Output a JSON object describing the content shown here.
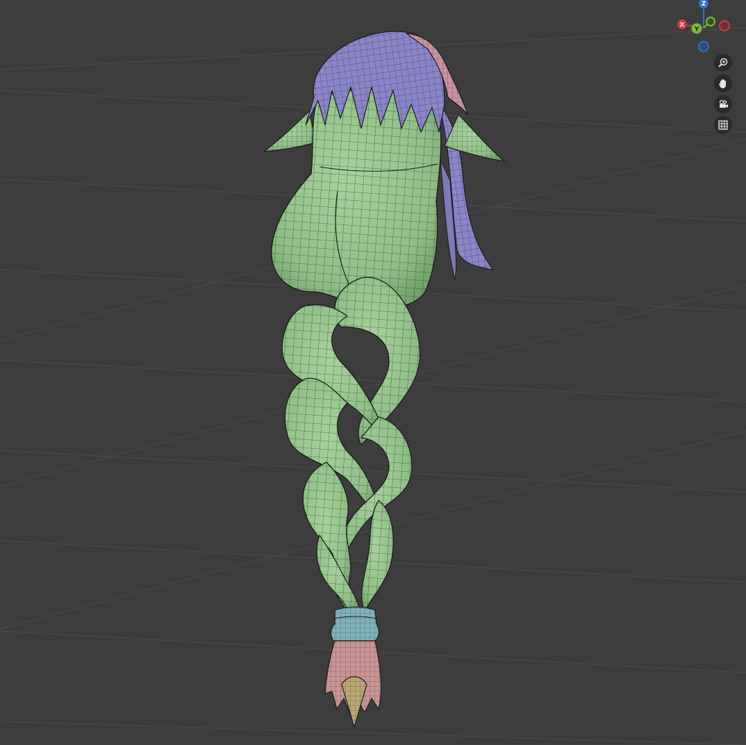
{
  "viewport": {
    "background": "#3d3d3d",
    "grid_color": "#4a4a4a"
  },
  "gizmo": {
    "x_label": "X",
    "y_label": "Y",
    "z_label": "Z",
    "x_color": "#d6344a",
    "y_color": "#7cbf24",
    "z_color": "#2f73c7"
  },
  "nav_buttons": [
    {
      "name": "zoom",
      "icon": "zoom-icon"
    },
    {
      "name": "pan",
      "icon": "hand-icon"
    },
    {
      "name": "camera",
      "icon": "camera-icon"
    },
    {
      "name": "ortho",
      "icon": "grid-icon"
    }
  ],
  "model": {
    "name": "braid-character-mesh",
    "colors": {
      "body": "#8fbf86",
      "hair": "#8a86c8",
      "ribbon": "#c9949f",
      "band": "#7fb2bd",
      "tassel": "#c99595",
      "tip": "#b9a874",
      "wire": "#1a1a1a"
    }
  }
}
